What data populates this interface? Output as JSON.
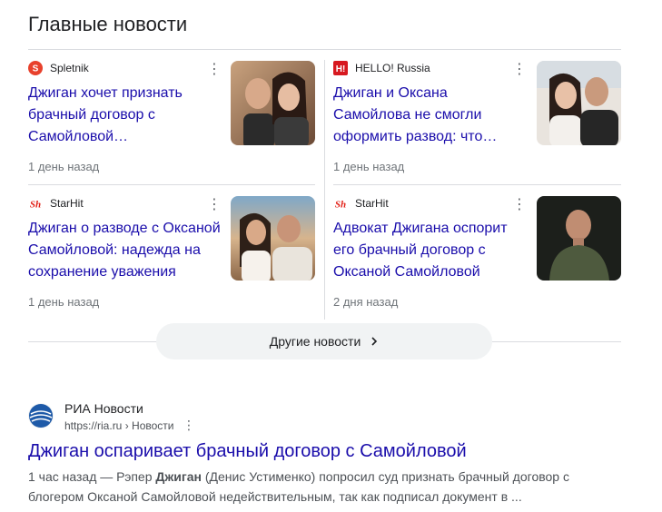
{
  "section": {
    "title": "Главные новости"
  },
  "cards": [
    {
      "source": "Spletnik",
      "headline": "Джиган хочет признать брачный договор с Самойловой…",
      "time": "1 день назад",
      "logo_icon": "spletnik-logo",
      "logo_color": "#e8412c"
    },
    {
      "source": "HELLO! Russia",
      "headline": "Джиган и Оксана Самойлова не смогли оформить развод: что…",
      "time": "1 день назад",
      "logo_icon": "hello-logo",
      "logo_color": "#d71920"
    },
    {
      "source": "StarHit",
      "headline": "Джиган о разводе с Оксаной Самойловой: надежда на сохранение уважения",
      "time": "1 день назад",
      "logo_icon": "starhit-logo",
      "logo_color": "#e2231a"
    },
    {
      "source": "StarHit",
      "headline": "Адвокат Джигана оспорит его брачный договор с Оксаной Самойловой",
      "time": "2 дня назад",
      "logo_icon": "starhit-logo",
      "logo_color": "#e2231a"
    }
  ],
  "more": {
    "label": "Другие новости"
  },
  "result": {
    "site_name": "РИА Новости",
    "url": "https://ria.ru › Новости",
    "title": "Джиган оспаривает брачный договор с Самойловой",
    "snippet_pre": "1 час назад — Рэпер ",
    "snippet_bold": "Джиган",
    "snippet_post": " (Денис Устименко) попросил суд признать брачный договор с блогером Оксаной Самойловой недействительным, так как подписал документ в ..."
  }
}
